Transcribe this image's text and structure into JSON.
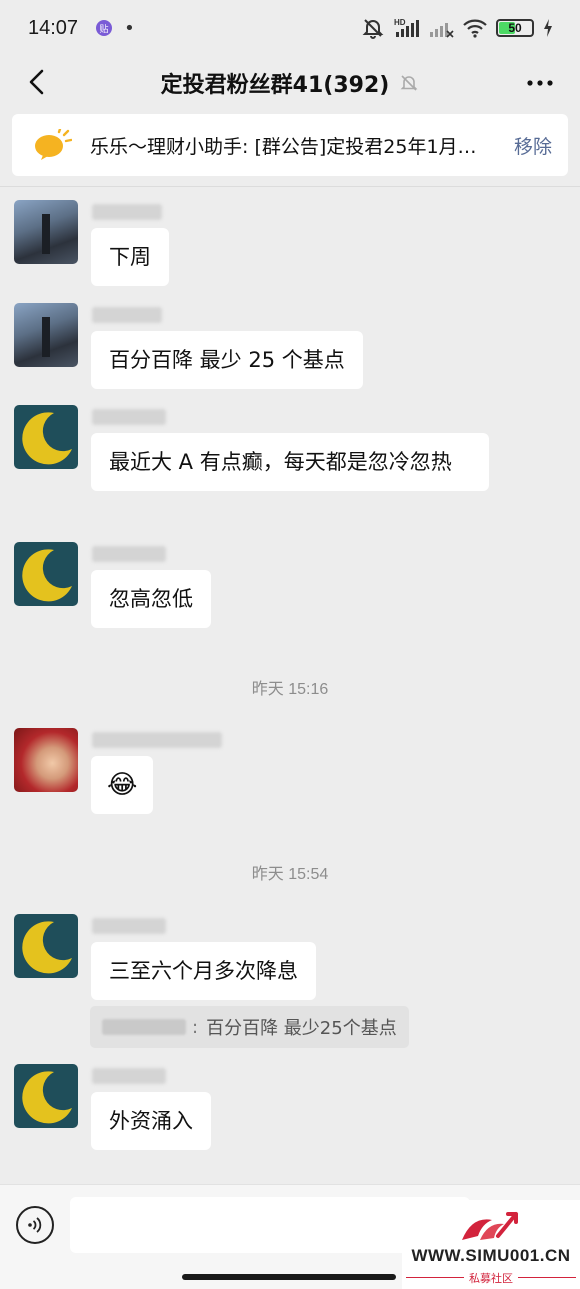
{
  "status_bar": {
    "time": "14:07",
    "app_badge": "贴",
    "dot": "•",
    "battery": "50",
    "battery_level": 0.5
  },
  "header": {
    "title": "定投君粉丝群41(392)"
  },
  "announcement": {
    "text": "乐乐～理财小助手: [群公告]定投君25年1月…",
    "remove_label": "移除"
  },
  "messages": [
    {
      "id": "m1",
      "text": "下周"
    },
    {
      "id": "m2",
      "text": "百分百降 最少 25 个基点"
    },
    {
      "id": "m3",
      "text": "最近大 A 有点癫，每天都是忽冷忽热"
    },
    {
      "id": "m4",
      "text": "忽高忽低"
    },
    {
      "id": "m5",
      "text": "😂"
    },
    {
      "id": "m6",
      "text": "三至六个月多次降息"
    },
    {
      "id": "m7",
      "text": "外资涌入"
    }
  ],
  "timestamps": [
    "昨天 15:16",
    "昨天 15:54"
  ],
  "quote": {
    "text": "百分百降 最少25个基点"
  },
  "input": {
    "value": "",
    "placeholder": ""
  },
  "watermark": {
    "url": "WWW.SIMU001.CN",
    "subtitle": "私募社区"
  },
  "colors": {
    "background": "#ededed",
    "bubble": "#ffffff",
    "link": "#576b95",
    "watermark_red": "#d2233c"
  }
}
